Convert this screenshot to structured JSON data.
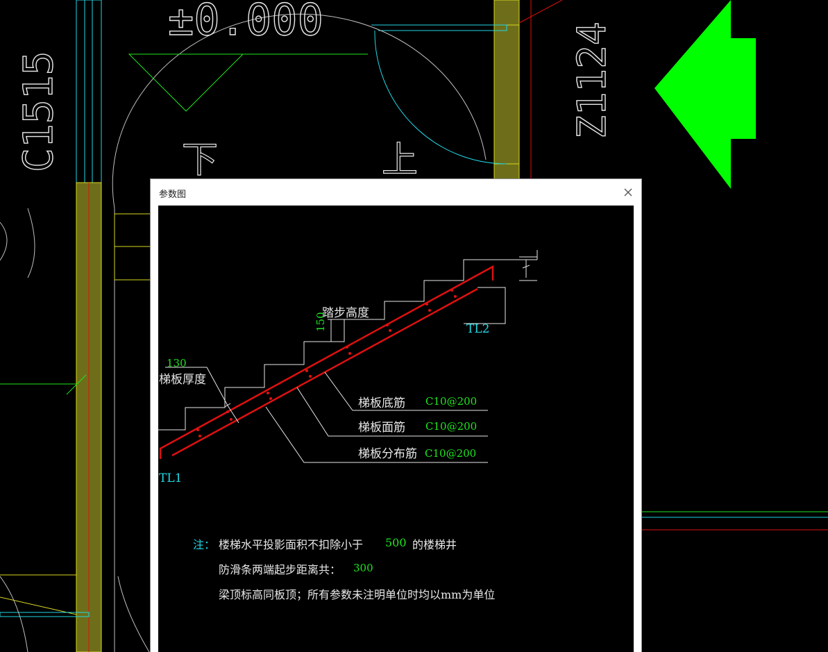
{
  "background_cad": {
    "labels": {
      "elevation": "±0.000",
      "window_tag": "C1515",
      "door_tag": "Z1124",
      "down": "下",
      "up": "上"
    },
    "colors": {
      "background": "#000000",
      "wall_fill": "#6e6e1a",
      "arrow": "#00ff00",
      "cyan": "#20d8e6",
      "red": "#e01010",
      "yellow": "#d8d820"
    },
    "icons": [
      "green-arrow-left-icon"
    ]
  },
  "dialog": {
    "title": "参数图",
    "close_icon": "close-icon",
    "diagram": {
      "slab_thickness_value": "130",
      "slab_thickness_label": "梯板厚度",
      "step_height_label": "踏步高度",
      "step_height_value": "150",
      "beam_top": "TL2",
      "beam_bottom": "TL1",
      "rebars": [
        {
          "label": "梯板底筋",
          "value": "C10@200"
        },
        {
          "label": "梯板面筋",
          "value": "C10@200"
        },
        {
          "label": "梯板分布筋",
          "value": "C10@200"
        }
      ]
    },
    "notes": {
      "prefix": "注：",
      "line1_a": "楼梯水平投影面积不扣除小于",
      "line1_value": "500",
      "line1_b": "的楼梯井",
      "line2_a": "防滑条两端起步距离共：",
      "line2_value": "300",
      "line3": "梁顶标高同板顶；所有参数未注明单位时均以mm为单位"
    }
  }
}
